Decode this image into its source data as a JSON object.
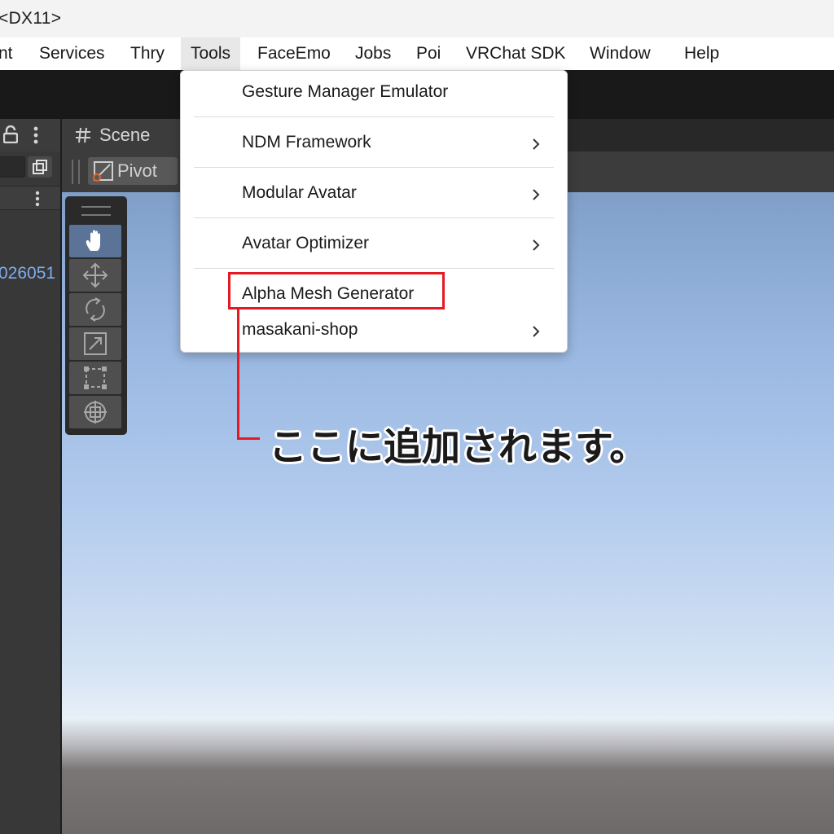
{
  "window": {
    "title_fragment": "<DX11>"
  },
  "menubar": {
    "items": [
      {
        "label": "nt"
      },
      {
        "label": "Services"
      },
      {
        "label": "Thry"
      },
      {
        "label": "Tools"
      },
      {
        "label": "FaceEmo"
      },
      {
        "label": "Jobs"
      },
      {
        "label": "Poi"
      },
      {
        "label": "VRChat SDK"
      },
      {
        "label": "Window"
      },
      {
        "label": "Help"
      }
    ],
    "active": "Tools"
  },
  "hierarchy": {
    "item_fragment": "026051"
  },
  "scene": {
    "tab_label": "Scene",
    "pivot_label": "Pivot",
    "tools": [
      "hand-tool",
      "move-tool",
      "rotate-tool",
      "scale-tool",
      "rect-tool",
      "transform-tool"
    ],
    "selected_tool": "hand-tool"
  },
  "dropdown": {
    "items": [
      {
        "label": "Gesture Manager Emulator",
        "submenu": false
      },
      {
        "label": "NDM Framework",
        "submenu": true
      },
      {
        "label": "Modular Avatar",
        "submenu": true
      },
      {
        "label": "Avatar Optimizer",
        "submenu": true
      },
      {
        "label": "Alpha Mesh Generator",
        "submenu": false
      },
      {
        "label": "masakani-shop",
        "submenu": true
      }
    ]
  },
  "annotation": {
    "text": "ここに追加されます。",
    "highlight_color": "#e51922"
  }
}
